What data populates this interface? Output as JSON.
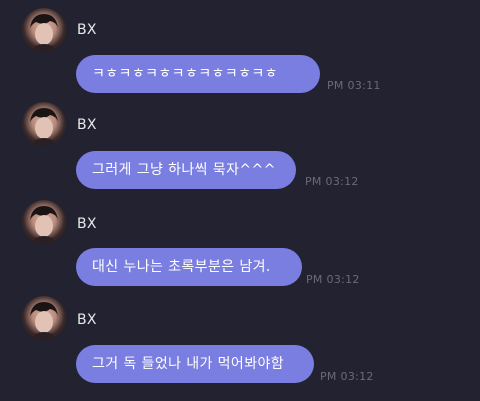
{
  "messages": [
    {
      "sender": "BX",
      "text": "ㅋㅎㅋㅎㅋㅎㅋㅎㅋㅎㅋㅎㅋㅎ",
      "time": "PM 03:11"
    },
    {
      "sender": "BX",
      "text": "그러게 그냥 하나씩 묵자^^^",
      "time": "PM 03:12"
    },
    {
      "sender": "BX",
      "text": "대신 누나는 초록부분은 남겨.",
      "time": "PM 03:12"
    },
    {
      "sender": "BX",
      "text": "그거 독 들었나 내가 먹어봐야함",
      "time": "PM 03:12"
    }
  ],
  "colors": {
    "background": "#222230",
    "bubble": "#7a7ee0",
    "bubble_text": "#ffffff",
    "time_text": "#6a6a78",
    "sender_text": "#e8e8ee"
  }
}
